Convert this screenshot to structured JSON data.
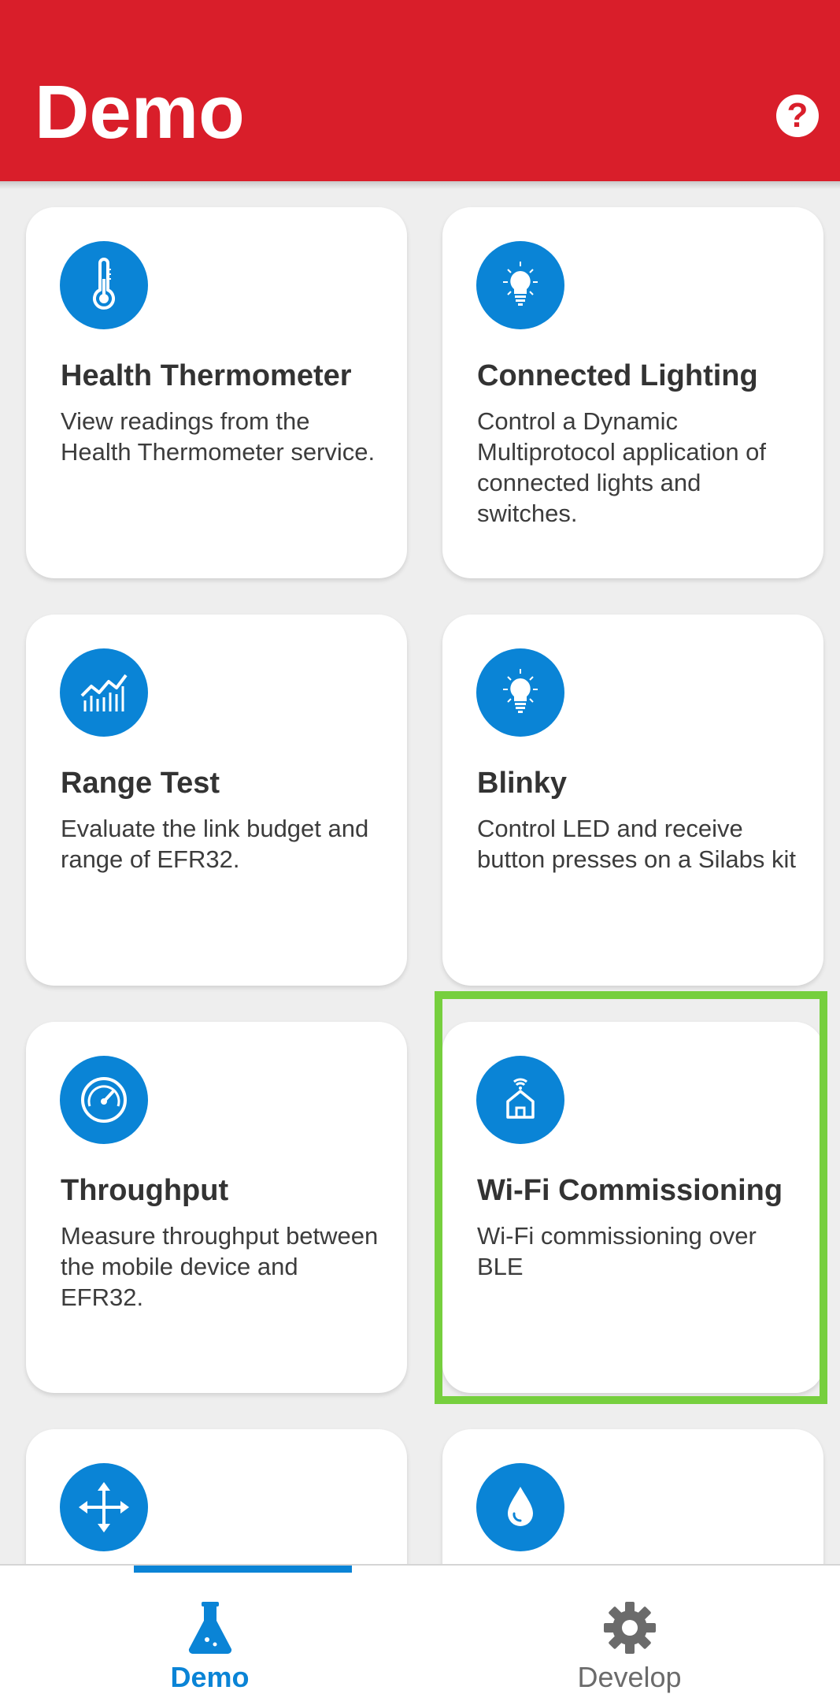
{
  "header": {
    "title": "Demo",
    "help_symbol": "?"
  },
  "colors": {
    "brand_red": "#d91e2a",
    "accent_blue": "#0a84d6",
    "highlight_green": "#76cf3e"
  },
  "cards": [
    {
      "title": "Health Thermometer",
      "description": "View readings from the Health Thermometer service.",
      "icon": "thermometer-icon"
    },
    {
      "title": "Connected Lighting",
      "description": "Control a Dynamic Multiprotocol application of connected lights and switches.",
      "icon": "lightbulb-icon"
    },
    {
      "title": "Range Test",
      "description": "Evaluate the link budget and range of EFR32.",
      "icon": "range-chart-icon"
    },
    {
      "title": "Blinky",
      "description": "Control LED and receive button presses on a Silabs kit",
      "icon": "lightbulb-icon"
    },
    {
      "title": "Throughput",
      "description": "Measure throughput between the mobile device and EFR32.",
      "icon": "speedometer-icon"
    },
    {
      "title": "Wi-Fi Commissioning",
      "description": "Wi-Fi commissioning over BLE",
      "icon": "wifi-home-icon"
    },
    {
      "title": "",
      "description": "",
      "icon": "move-arrows-icon"
    },
    {
      "title": "",
      "description": "",
      "icon": "water-drop-icon"
    }
  ],
  "bottom_nav": {
    "tabs": [
      {
        "label": "Demo",
        "icon": "flask-icon",
        "active": true
      },
      {
        "label": "Develop",
        "icon": "gear-icon",
        "active": false
      }
    ]
  }
}
